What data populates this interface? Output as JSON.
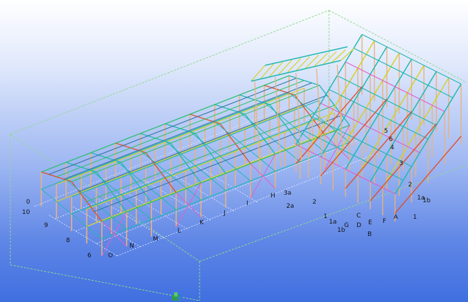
{
  "viewport": {
    "background_top": "#ffffff",
    "background_bottom": "#3f6fe0"
  },
  "grid_labels": {
    "main_letters": [
      "N",
      "M",
      "L",
      "K",
      "J",
      "I",
      "H"
    ],
    "row_numbers": [
      "0",
      "10",
      "9",
      "8",
      "6"
    ],
    "o_label": "O",
    "wing_labels": [
      "3a",
      "2a",
      "2",
      "1",
      "1a",
      "1b"
    ],
    "wing_letters": [
      "G",
      "D",
      "E",
      "F",
      "A",
      "C",
      "B"
    ],
    "right_labels": [
      "1",
      "1a",
      "1b",
      "2",
      "3",
      "4",
      "5",
      "6"
    ]
  },
  "colors": {
    "bounding_box": "#8fd88f",
    "grid_line": "#e8f0ff",
    "column": "#e9b27c",
    "beam": "#20b8b0",
    "purlin": "#2e6f9e",
    "rafter_red": "#e0502c",
    "rafter_yellow": "#d8d020",
    "bracing_pink": "#e060c8",
    "bracing_green": "#30c060"
  },
  "axis_triad_icon": "axis-triad-icon"
}
